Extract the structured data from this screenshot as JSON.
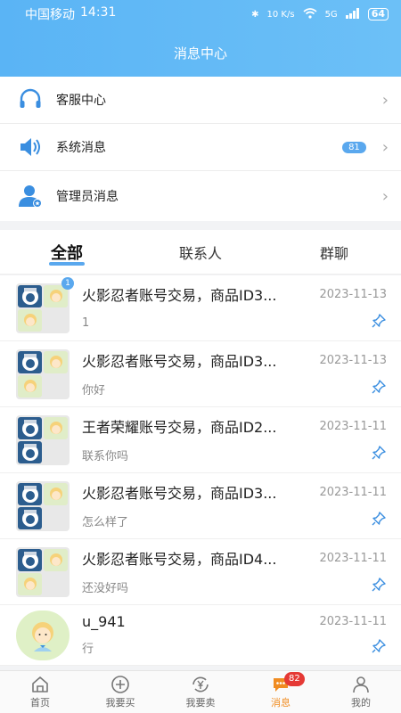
{
  "status_bar": {
    "carrier": "中国移动",
    "time": "14:31",
    "network_speed": "10 K/s",
    "signal": "5G",
    "battery": "64"
  },
  "header": {
    "title": "消息中心"
  },
  "menu": [
    {
      "label": "客服中心",
      "icon": "headset-icon",
      "badge": ""
    },
    {
      "label": "系统消息",
      "icon": "speaker-icon",
      "badge": "81"
    },
    {
      "label": "管理员消息",
      "icon": "admin-user-icon",
      "badge": ""
    }
  ],
  "tabs": [
    {
      "label": "全部",
      "active": true
    },
    {
      "label": "联系人",
      "active": false
    },
    {
      "label": "群聊",
      "active": false
    }
  ],
  "chats": [
    {
      "title": "火影忍者账号交易，商品ID3...",
      "date": "2023-11-13",
      "message": "1",
      "unread": "1"
    },
    {
      "title": "火影忍者账号交易，商品ID3...",
      "date": "2023-11-13",
      "message": "你好",
      "unread": ""
    },
    {
      "title": "王者荣耀账号交易，商品ID2...",
      "date": "2023-11-11",
      "message": "联系你吗",
      "unread": ""
    },
    {
      "title": "火影忍者账号交易，商品ID3...",
      "date": "2023-11-11",
      "message": "怎么样了",
      "unread": ""
    },
    {
      "title": "火影忍者账号交易，商品ID4...",
      "date": "2023-11-11",
      "message": "还没好吗",
      "unread": ""
    },
    {
      "title": "u_941",
      "date": "2023-11-11",
      "message": "行",
      "unread": ""
    }
  ],
  "tabbar": [
    {
      "label": "首页",
      "icon": "home-icon",
      "badge": ""
    },
    {
      "label": "我要买",
      "icon": "plus-circle-icon",
      "badge": ""
    },
    {
      "label": "我要卖",
      "icon": "yen-exchange-icon",
      "badge": ""
    },
    {
      "label": "消息",
      "icon": "chat-bubble-icon",
      "badge": "82",
      "active": true
    },
    {
      "label": "我的",
      "icon": "user-icon",
      "badge": ""
    }
  ],
  "colors": {
    "accent": "#5aa8ee",
    "active_tab": "#f08c21",
    "badge_red": "#e53935"
  }
}
